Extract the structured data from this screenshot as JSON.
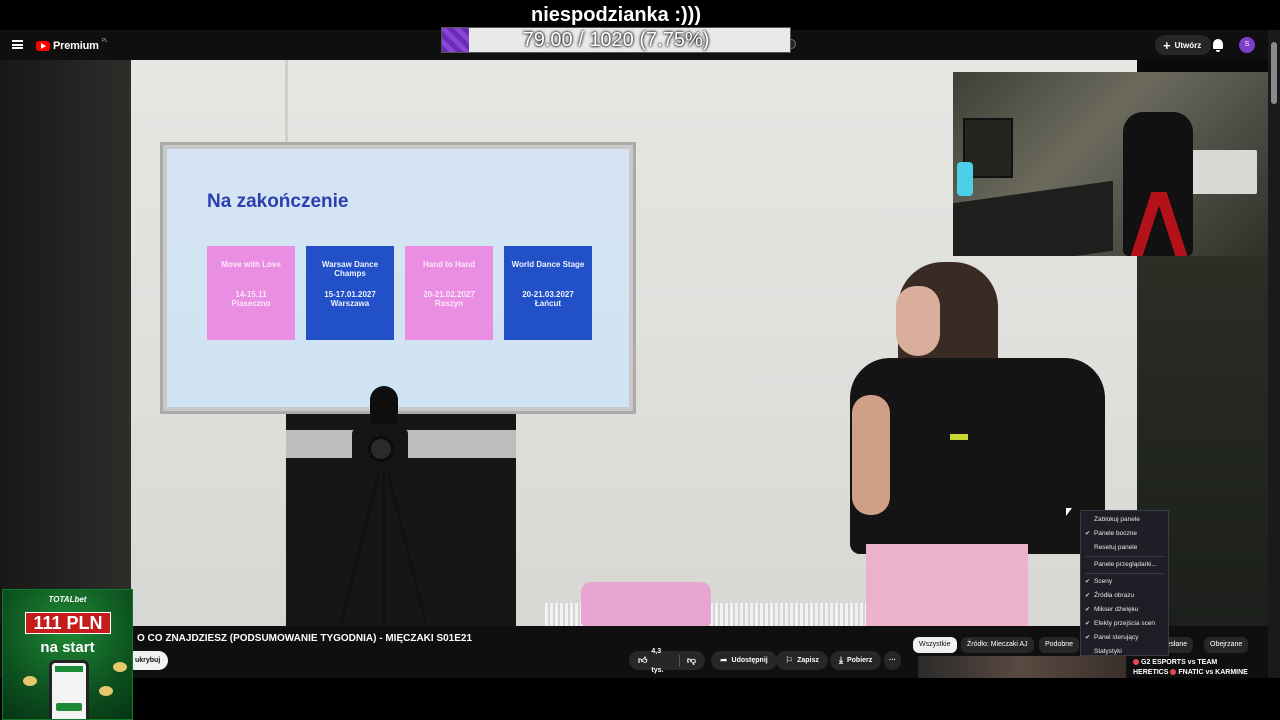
{
  "overlay": {
    "title": "niespodzianka :)))",
    "goal_text": "79.00 / 1020 (7.75%)",
    "goal_fraction": 0.0775
  },
  "topbar": {
    "logo": "Premium",
    "logo_region": "PL",
    "create_label": "Utwórz",
    "avatar_letter": "S"
  },
  "slide": {
    "title": "Na zakończenie",
    "events": [
      {
        "name": "Move with Love",
        "dates": "14-15.11",
        "place": "Piaseczno",
        "color": "pink"
      },
      {
        "name": "Warsaw Dance Champs",
        "dates": "15-17.01.2027",
        "place": "Warszawa",
        "color": "blue"
      },
      {
        "name": "Hand to Hand",
        "dates": "20-21.02.2027",
        "place": "Raszyn",
        "color": "pink"
      },
      {
        "name": "World Dance Stage",
        "dates": "20-21.03.2027",
        "place": "Łańcut",
        "color": "blue"
      }
    ]
  },
  "context_menu": {
    "items": [
      {
        "label": "Zablokuj panele",
        "checked": false
      },
      {
        "label": "Panele boczne",
        "checked": true
      },
      {
        "label": "Resetuj panele",
        "checked": false
      },
      {
        "label": "Panele przeglądarki...",
        "checked": false
      },
      {
        "label": "Sceny",
        "checked": true
      },
      {
        "label": "Źródła obrazu",
        "checked": true
      },
      {
        "label": "Mikser dźwięku",
        "checked": true
      },
      {
        "label": "Efekty przejścia scen",
        "checked": true
      },
      {
        "label": "Panel sterujący",
        "checked": true
      },
      {
        "label": "Statystyki",
        "checked": false
      }
    ]
  },
  "video_info": {
    "title": "O CO ZNAJDZIESZ (PODSUMOWANIE TYGODNIA) - MIĘCZAKI S01E21",
    "subscribe_label": "ukrybuj",
    "likes": "4,3 tys.",
    "share": "Udostępnij",
    "save": "Zapisz",
    "download": "Pobierz",
    "more": "···"
  },
  "chips": [
    "Wszystkie",
    "Źródło: Mieczaki AJ",
    "Podobne",
    "Przesłane",
    "Obejrzane"
  ],
  "recommendation": {
    "line1": "G2 ESPORTS vs TEAM",
    "line2": "HERETICS",
    "line2b": "FNATIC vs KARMINE"
  },
  "ad": {
    "brand": "TOTALbet",
    "amount": "111 PLN",
    "subtitle": "na start"
  },
  "colors": {
    "accent_purple": "#7b3fc9",
    "slide_pink": "#e98ee3",
    "slide_blue": "#2150c7",
    "ad_green": "#0d5220",
    "ad_red": "#c51b1b"
  }
}
